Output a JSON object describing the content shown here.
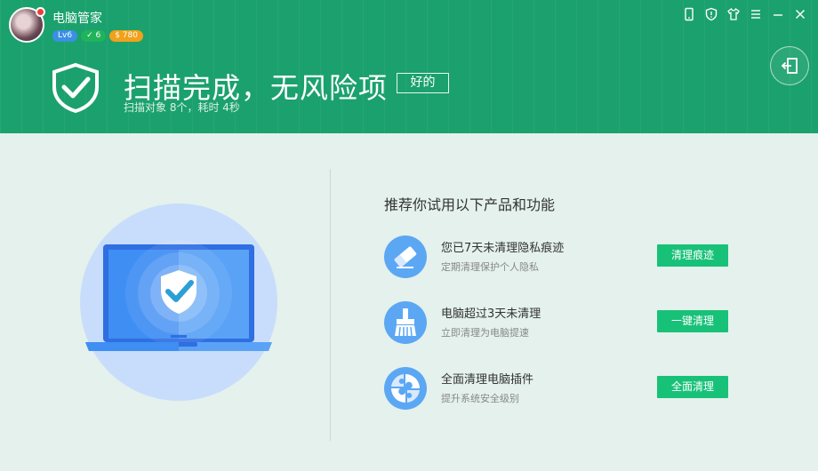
{
  "app": {
    "title": "电脑管家",
    "badges": {
      "level": "Lv6",
      "checks": "✓ 6",
      "coins": "$ 780"
    }
  },
  "window_controls": [
    {
      "name": "phone-icon"
    },
    {
      "name": "shield-icon"
    },
    {
      "name": "skin-icon"
    },
    {
      "name": "menu-icon"
    },
    {
      "name": "minimize-icon"
    },
    {
      "name": "close-icon"
    }
  ],
  "result": {
    "headline": "扫描完成，无风险项",
    "ok_label": "好的",
    "subline": "扫描对象 8个，耗时 4秒"
  },
  "recommend": {
    "title": "推荐你试用以下产品和功能",
    "items": [
      {
        "icon": "eraser-icon",
        "main": "您已7天未清理隐私痕迹",
        "sub": "定期清理保护个人隐私",
        "button": "清理痕迹"
      },
      {
        "icon": "broom-icon",
        "main": "电脑超过3天未清理",
        "sub": "立即清理为电脑提速",
        "button": "一键清理"
      },
      {
        "icon": "puzzle-icon",
        "main": "全面清理电脑插件",
        "sub": "提升系统安全级别",
        "button": "全面清理"
      }
    ]
  },
  "colors": {
    "header_green": "#1ba16d",
    "accent_button": "#18c178",
    "icon_blue": "#5ba7f4",
    "body_bg": "#e4f1ec"
  }
}
